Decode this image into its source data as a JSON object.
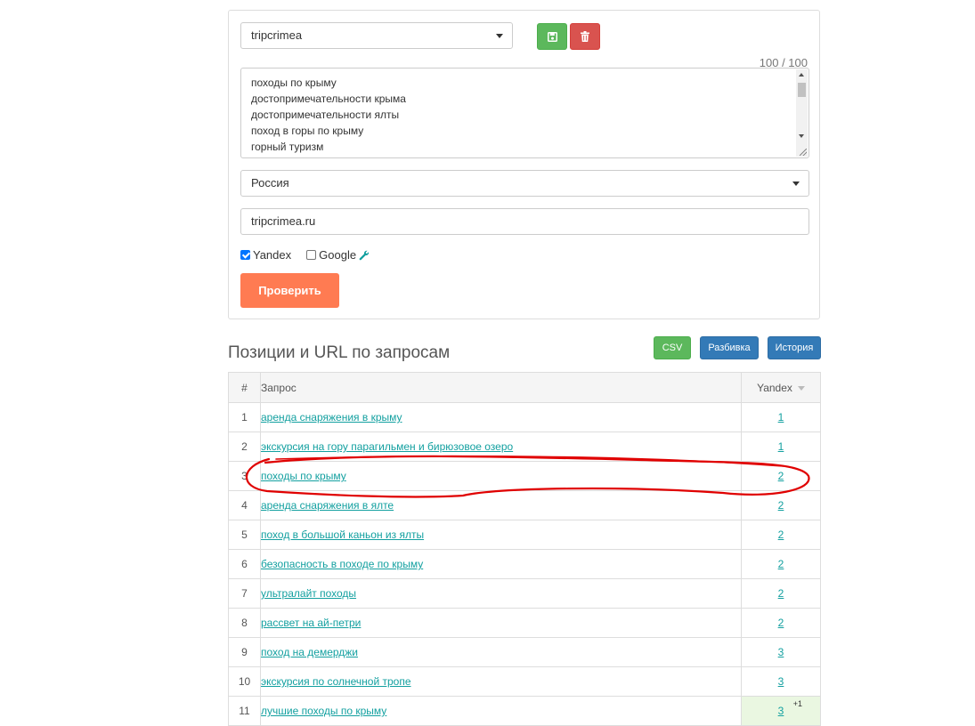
{
  "form": {
    "project_value": "tripcrimea",
    "counter": "100 / 100",
    "queries": [
      "походы по крыму",
      "достопримечательности крыма",
      "достопримечательности ялты",
      "поход в горы по крыму",
      "горный туризм"
    ],
    "region_value": "Россия",
    "domain_value": "tripcrimea.ru",
    "yandex_label": "Yandex",
    "yandex_checked": true,
    "google_label": "Google",
    "google_checked": false,
    "submit_label": "Проверить"
  },
  "results": {
    "title": "Позиции и URL по запросам",
    "buttons": {
      "csv": "CSV",
      "breakdown": "Разбивка",
      "history": "История"
    },
    "columns": {
      "num": "#",
      "query": "Запрос",
      "yandex": "Yandex"
    },
    "rows": [
      {
        "num": "1",
        "query": "аренда снаряжения в крыму",
        "yandex": "1"
      },
      {
        "num": "2",
        "query": "экскурсия на гору парагильмен и бирюзовое озеро",
        "yandex": "1"
      },
      {
        "num": "3",
        "query": "походы по крыму",
        "yandex": "2",
        "highlighted": true
      },
      {
        "num": "4",
        "query": "аренда снаряжения в ялте",
        "yandex": "2"
      },
      {
        "num": "5",
        "query": "поход в большой каньон из ялты",
        "yandex": "2"
      },
      {
        "num": "6",
        "query": "безопасность в походе по крыму",
        "yandex": "2"
      },
      {
        "num": "7",
        "query": "ультралайт походы",
        "yandex": "2"
      },
      {
        "num": "8",
        "query": "рассвет на ай-петри",
        "yandex": "2"
      },
      {
        "num": "9",
        "query": "поход на демерджи",
        "yandex": "3"
      },
      {
        "num": "10",
        "query": "экскурсия по солнечной тропе",
        "yandex": "3"
      },
      {
        "num": "11",
        "query": "лучшие походы по крыму",
        "yandex": "3",
        "delta": "+1"
      }
    ]
  },
  "colors": {
    "accent": "#ff7b52",
    "link": "#13a0a0",
    "success": "#5cb85c",
    "danger": "#d9534f",
    "primary": "#337ab7",
    "annotation": "#e00000"
  }
}
